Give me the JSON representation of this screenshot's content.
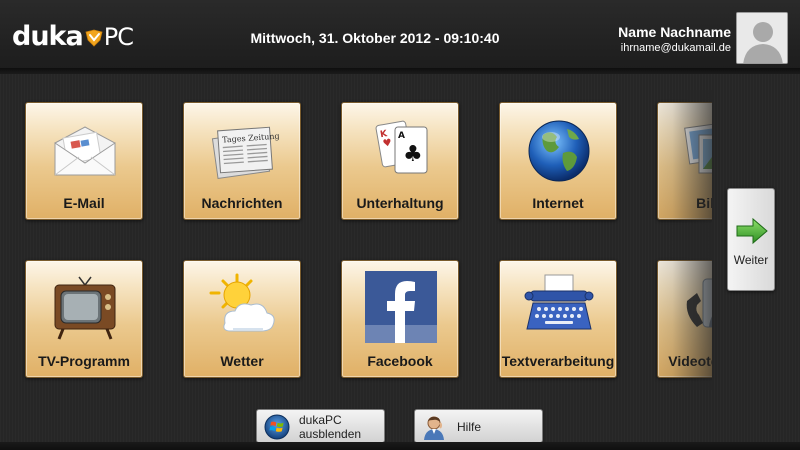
{
  "brand": {
    "name_bold": "duka",
    "name_light": "PC"
  },
  "header": {
    "datetime": "Mittwoch, 31. Oktober 2012 - 09:10:40",
    "user_name": "Name Nachname",
    "user_email": "ihrname@dukamail.de"
  },
  "tiles": [
    {
      "label": "E-Mail",
      "icon": "envelope-icon"
    },
    {
      "label": "Nachrichten",
      "icon": "newspaper-icon"
    },
    {
      "label": "Unterhaltung",
      "icon": "playing-cards-icon"
    },
    {
      "label": "Internet",
      "icon": "globe-icon"
    },
    {
      "label": "Bilder",
      "icon": "photos-icon"
    },
    {
      "label": "TV-Programm",
      "icon": "tv-icon"
    },
    {
      "label": "Wetter",
      "icon": "sun-cloud-icon"
    },
    {
      "label": "Facebook",
      "icon": "facebook-icon"
    },
    {
      "label": "Textverarbeitung",
      "icon": "typewriter-icon"
    },
    {
      "label": "Videotelefonie",
      "icon": "video-phone-icon"
    }
  ],
  "nav": {
    "next_label": "Weiter"
  },
  "bottom_buttons": {
    "hide_line1": "dukaPC",
    "hide_line2": "ausblenden",
    "help": "Hilfe"
  },
  "colors": {
    "background": "#262626",
    "tile_gradient_top": "#fdf6e9",
    "tile_gradient_bottom": "#e0b066",
    "accent_green": "#3aa335",
    "logo_badge": "#f2a51e"
  }
}
